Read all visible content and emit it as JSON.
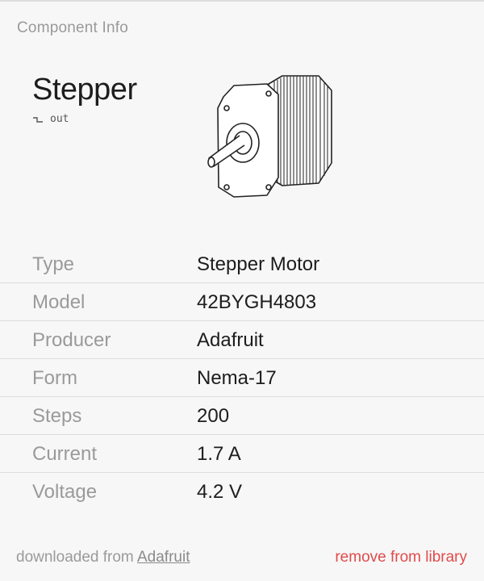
{
  "panel": {
    "title": "Component Info"
  },
  "component": {
    "name": "Stepper",
    "port_label": "out",
    "port_icon": "output-port-icon",
    "image_icon": "stepper-motor-illustration"
  },
  "properties": [
    {
      "label": "Type",
      "value": "Stepper Motor"
    },
    {
      "label": "Model",
      "value": "42BYGH4803"
    },
    {
      "label": "Producer",
      "value": "Adafruit"
    },
    {
      "label": "Form",
      "value": "Nema-17"
    },
    {
      "label": "Steps",
      "value": "200"
    },
    {
      "label": "Current",
      "value": "1.7 A"
    },
    {
      "label": "Voltage",
      "value": "4.2 V"
    }
  ],
  "footer": {
    "source_prefix": "downloaded from",
    "source_link": "Adafruit",
    "remove_label": "remove from library"
  },
  "colors": {
    "background": "#f7f7f7",
    "muted_text": "#9a9a9a",
    "danger": "#e04b4b"
  }
}
